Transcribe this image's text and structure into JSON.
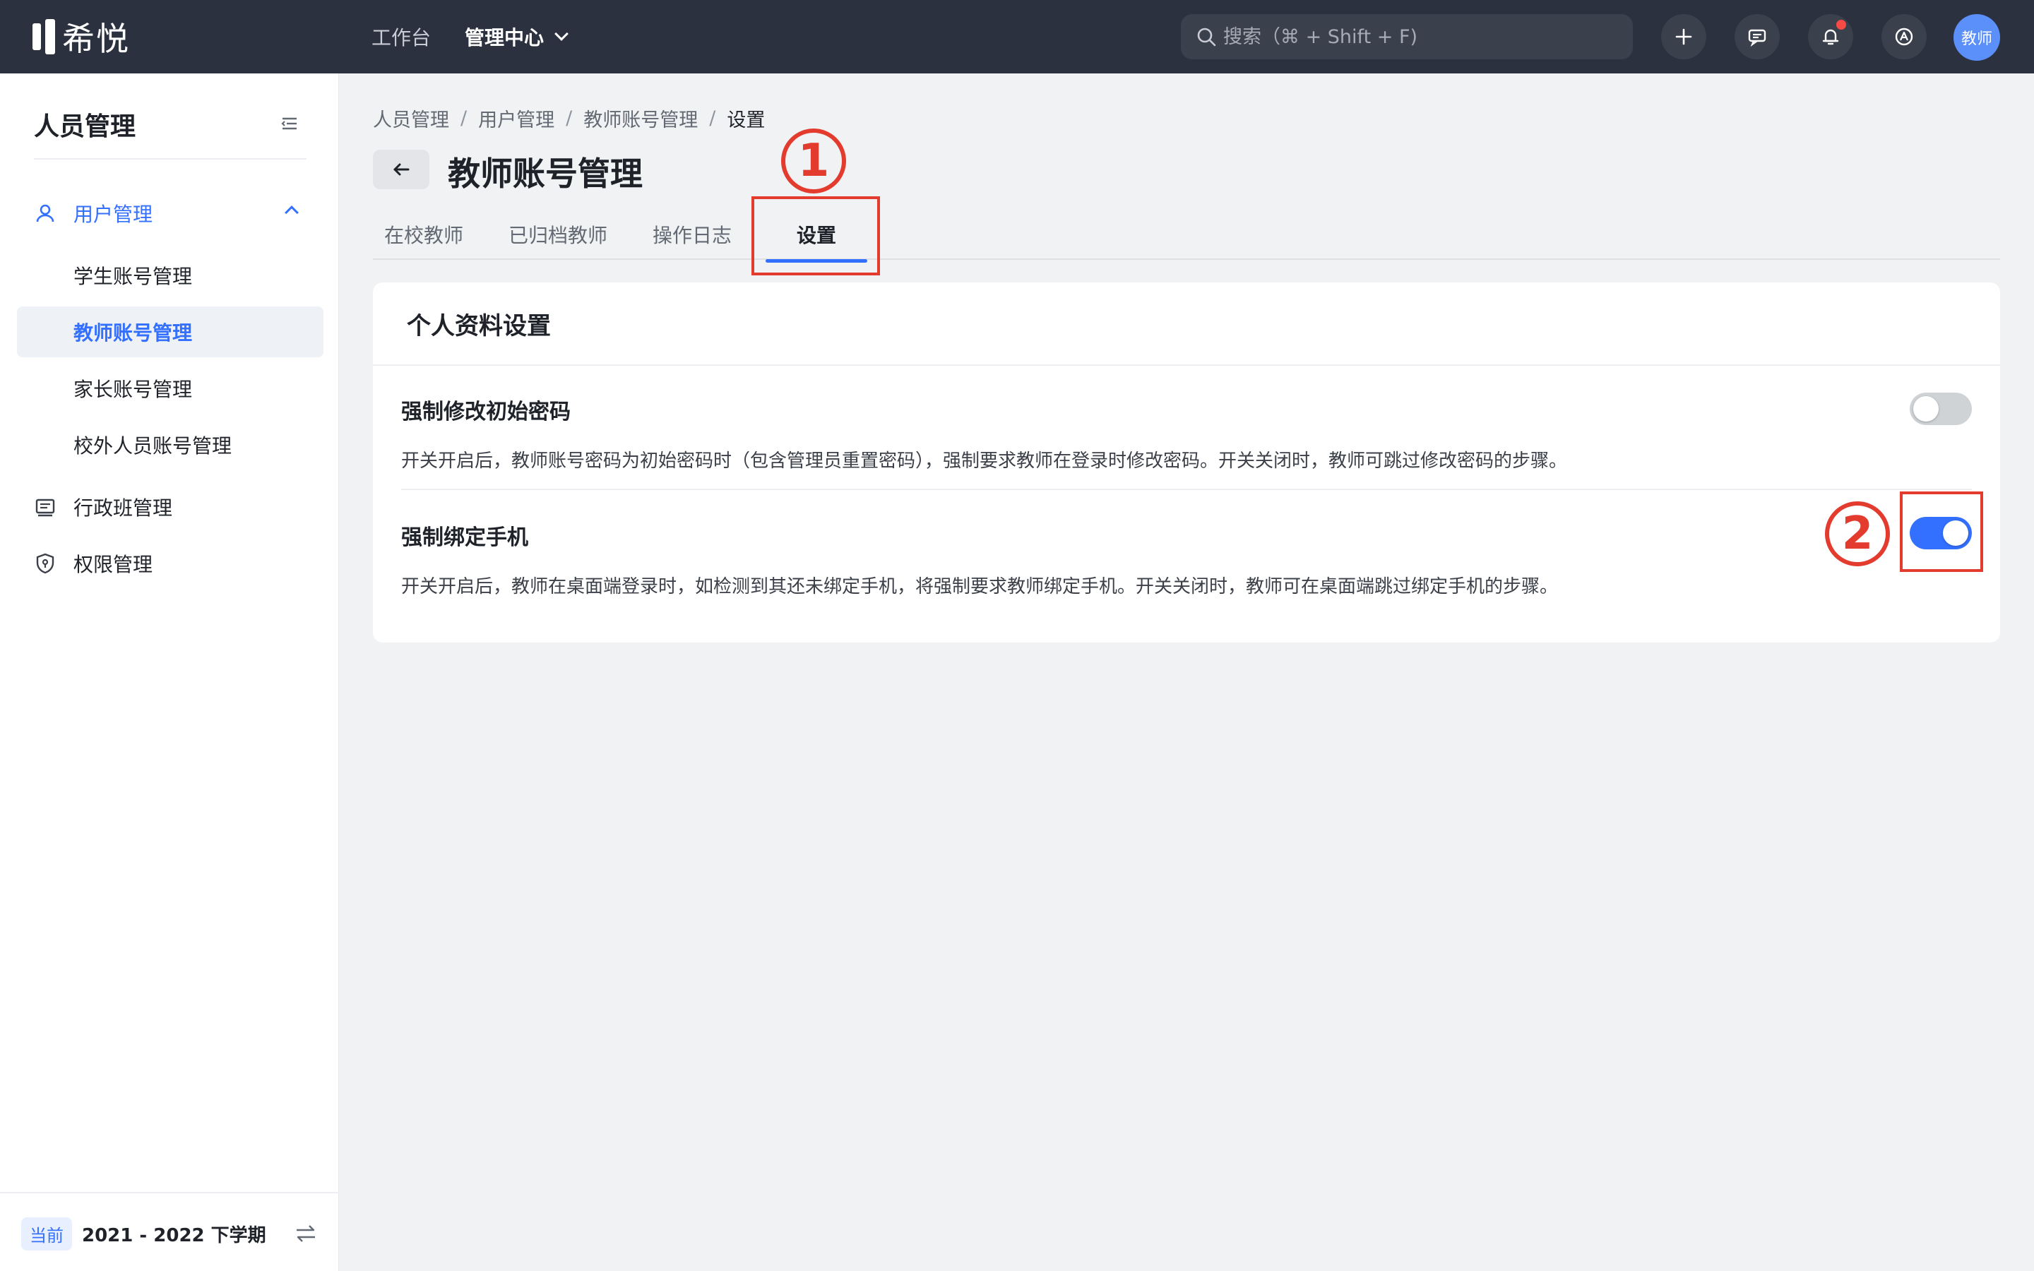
{
  "app": {
    "logo_text": "希悦"
  },
  "topnav": {
    "workbench": "工作台",
    "admin_center": "管理中心"
  },
  "search": {
    "placeholder": "搜索（⌘ + Shift + F)"
  },
  "topbar_icons": [
    "plus-icon",
    "message-icon",
    "bell-icon",
    "help-icon"
  ],
  "avatar": {
    "label": "教师"
  },
  "sidebar": {
    "title": "人员管理",
    "groups": {
      "user_mgmt": "用户管理",
      "class_mgmt": "行政班管理",
      "perm_mgmt": "权限管理"
    },
    "sub_items": [
      "学生账号管理",
      "教师账号管理",
      "家长账号管理",
      "校外人员账号管理"
    ],
    "active_sub": "教师账号管理",
    "footer": {
      "badge": "当前",
      "term": "2021 - 2022 下学期"
    }
  },
  "breadcrumb": {
    "items": [
      "人员管理",
      "用户管理",
      "教师账号管理",
      "设置"
    ],
    "sep": "/"
  },
  "page": {
    "title": "教师账号管理"
  },
  "tabs": [
    "在校教师",
    "已归档教师",
    "操作日志",
    "设置"
  ],
  "active_tab": "设置",
  "card": {
    "title": "个人资料设置",
    "settings": [
      {
        "title": "强制修改初始密码",
        "desc": "开关开启后，教师账号密码为初始密码时（包含管理员重置密码），强制要求教师在登录时修改密码。开关关闭时，教师可跳过修改密码的步骤。",
        "enabled": false
      },
      {
        "title": "强制绑定手机",
        "desc": "开关开启后，教师在桌面端登录时，如检测到其还未绑定手机，将强制要求教师绑定手机。开关关闭时，教师可在桌面端跳过绑定手机的步骤。",
        "enabled": true
      }
    ]
  },
  "annotations": {
    "step1": "1",
    "step2": "2",
    "color": "#e33b2e"
  },
  "colors": {
    "accent": "#3370ff",
    "topbar": "#2c3140",
    "annotation": "#e33b2e"
  }
}
